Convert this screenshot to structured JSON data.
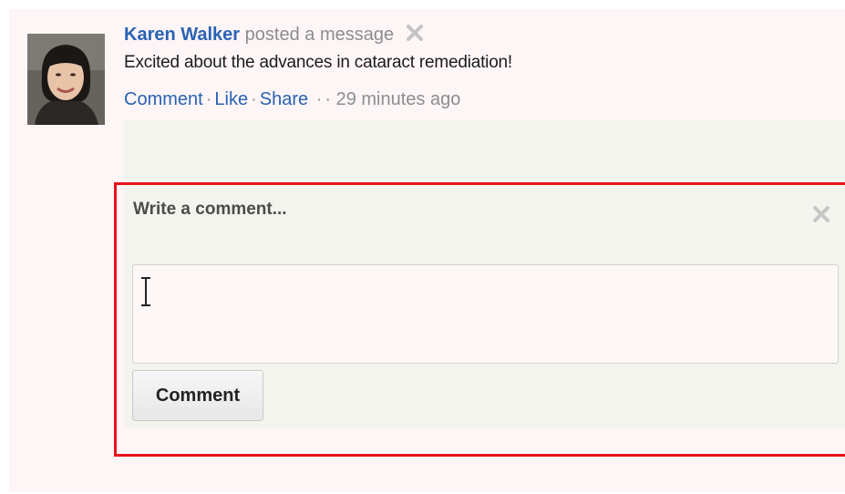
{
  "post": {
    "author": "Karen Walker",
    "action_text": "posted a message",
    "body": "Excited about the advances in cataract remediation!",
    "avatar_icon": "user-avatar-photo",
    "dismiss_icon": "close-icon"
  },
  "actions": {
    "comment": "Comment",
    "like": "Like",
    "share": "Share",
    "separator": "·",
    "timestamp": "· 29 minutes ago"
  },
  "comment_box": {
    "label": "Write a comment...",
    "close_icon": "close-icon",
    "input_value": "",
    "submit_label": "Comment"
  },
  "colors": {
    "link": "#2a62b4",
    "highlight": "#e8131a",
    "panel_background": "#fdf5f6",
    "comment_background": "#f4f4ef"
  }
}
